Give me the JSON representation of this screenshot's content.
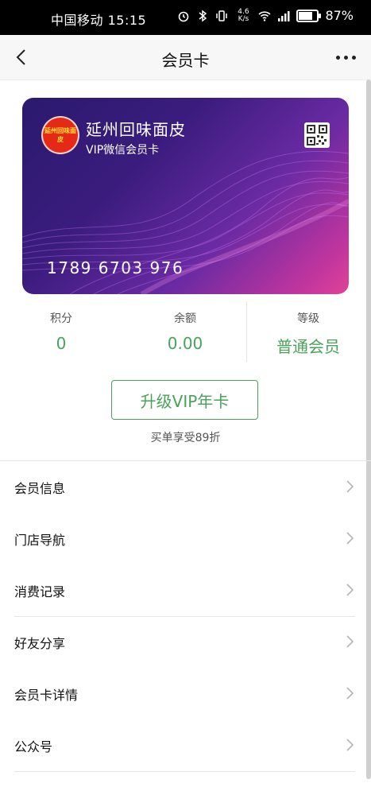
{
  "status": {
    "carrier_time": "中国移动 15:15",
    "net_speed": "4.6 K/s",
    "battery": "87%"
  },
  "nav": {
    "title": "会员卡"
  },
  "card": {
    "logo_text": "延州回味面皮",
    "merchant": "延州回味面皮",
    "type": "VIP微信会员卡",
    "number": "1789 6703 976"
  },
  "stats": [
    {
      "label": "积分",
      "value": "0"
    },
    {
      "label": "余额",
      "value": "0.00"
    },
    {
      "label": "等级",
      "value": "普通会员"
    }
  ],
  "upgrade": {
    "label": "升级VIP年卡",
    "note": "买单享受89折"
  },
  "menu": [
    {
      "label": "会员信息"
    },
    {
      "label": "门店导航"
    },
    {
      "label": "消费记录"
    },
    {
      "label": "好友分享"
    },
    {
      "label": "会员卡详情"
    },
    {
      "label": "公众号"
    }
  ],
  "colors": {
    "accent_green": "#4aa158"
  }
}
